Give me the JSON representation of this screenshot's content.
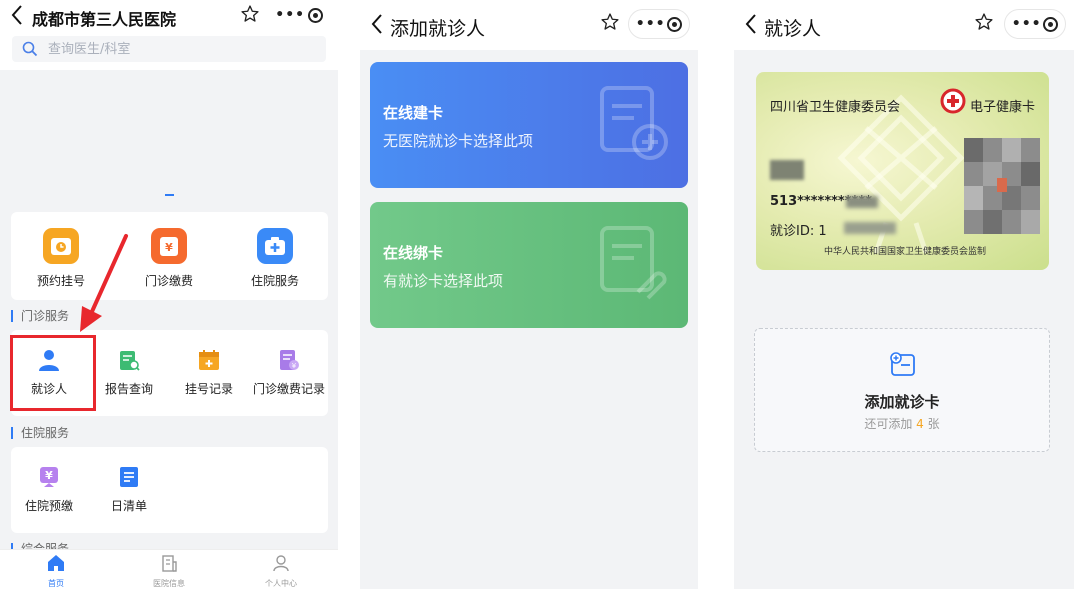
{
  "panel1": {
    "title": "成都市第三人民医院",
    "search_placeholder": "查询医生/科室",
    "quick": [
      "预约挂号",
      "门诊缴费",
      "住院服务"
    ],
    "section_outpatient": "门诊服务",
    "outpatient_items": [
      "就诊人",
      "报告查询",
      "挂号记录",
      "门诊缴费记录"
    ],
    "section_inpatient": "住院服务",
    "inpatient_items": [
      "住院预缴",
      "日清单"
    ],
    "section_more": "综合服务",
    "tabs": [
      "首页",
      "医院信息",
      "个人中心"
    ],
    "colors": {
      "accent": "#2f7bf5",
      "highlight": "#e8272d"
    }
  },
  "panel2": {
    "title": "添加就诊人",
    "card_create": {
      "title": "在线建卡",
      "subtitle": "无医院就诊卡选择此项"
    },
    "card_bind": {
      "title": "在线绑卡",
      "subtitle": "有就诊卡选择此项"
    }
  },
  "panel3": {
    "title": "就诊人",
    "health_card": {
      "issuer": "四川省卫生健康委员会",
      "brand": "电子健康卡",
      "id_number": "513***********",
      "visit_id_label": "就诊ID: 1",
      "footer": "中华人民共和国国家卫生健康委员会监制"
    },
    "add_card": {
      "title": "添加就诊卡",
      "prefix": "还可添加",
      "count": "4",
      "suffix": "张"
    }
  }
}
